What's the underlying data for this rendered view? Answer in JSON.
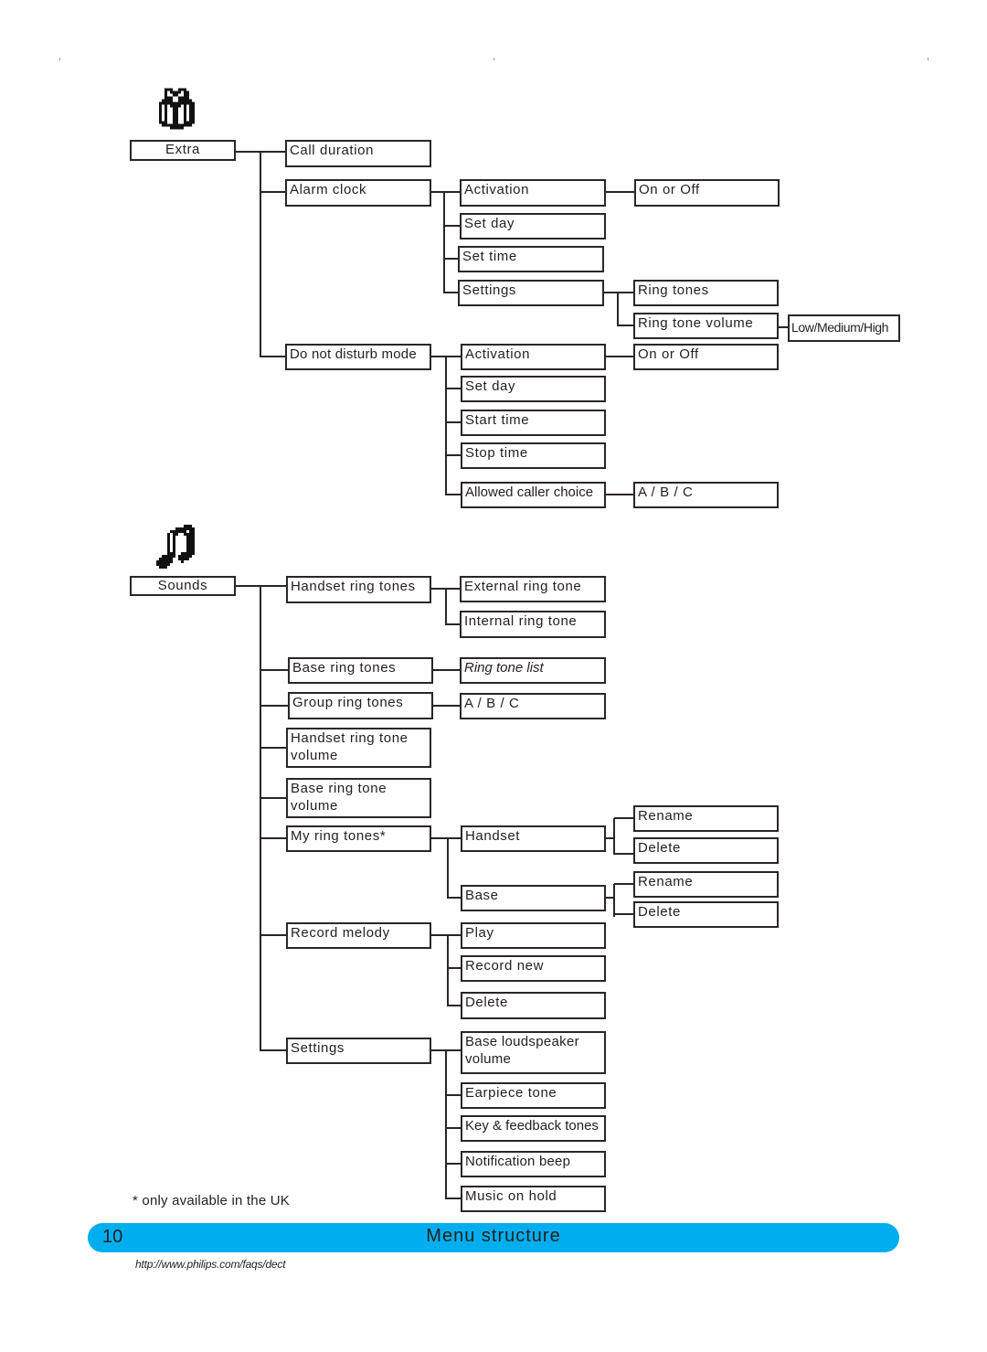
{
  "page": {
    "number": "10",
    "title": "Menu structure",
    "url": "http://www.philips.com/faqs/dect",
    "footnote": "* only available in the UK",
    "accent_color": "#00aeef"
  },
  "extra": {
    "icon": "gift-icon",
    "label": "Extra",
    "children": [
      {
        "label": "Call duration"
      },
      {
        "label": "Alarm clock",
        "children": [
          {
            "label": "Activation",
            "children": [
              {
                "label": "On or Off"
              }
            ]
          },
          {
            "label": "Set day"
          },
          {
            "label": "Set time"
          },
          {
            "label": "Settings",
            "children": [
              {
                "label": "Ring tones"
              },
              {
                "label": "Ring tone volume",
                "children": [
                  {
                    "label": "Low/Medium/High"
                  }
                ]
              }
            ]
          }
        ]
      },
      {
        "label": "Do not disturb mode",
        "children": [
          {
            "label": "Activation",
            "children": [
              {
                "label": "On or Off"
              }
            ]
          },
          {
            "label": "Set day"
          },
          {
            "label": "Start time"
          },
          {
            "label": "Stop time"
          },
          {
            "label": "Allowed caller choice",
            "children": [
              {
                "label": "A / B / C"
              }
            ]
          }
        ]
      }
    ]
  },
  "sounds": {
    "icon": "music-note-icon",
    "label": "Sounds",
    "children": [
      {
        "label": "Handset ring tones",
        "children": [
          {
            "label": "External ring tone"
          },
          {
            "label": "Internal ring tone"
          }
        ]
      },
      {
        "label": "Base ring tones",
        "children": [
          {
            "label": "Ring tone list"
          }
        ]
      },
      {
        "label": "Group ring tones",
        "children": [
          {
            "label": "A / B / C"
          }
        ]
      },
      {
        "label": "Handset ring tone volume"
      },
      {
        "label": "Base ring tone volume"
      },
      {
        "label": "My ring tones*",
        "children": [
          {
            "label": "Handset",
            "children": [
              {
                "label": "Rename"
              },
              {
                "label": "Delete"
              }
            ]
          },
          {
            "label": "Base",
            "children": [
              {
                "label": "Rename"
              },
              {
                "label": "Delete"
              }
            ]
          }
        ]
      },
      {
        "label": "Record melody",
        "children": [
          {
            "label": "Play"
          },
          {
            "label": "Record new"
          },
          {
            "label": "Delete"
          }
        ]
      },
      {
        "label": "Settings",
        "children": [
          {
            "label": "Base loudspeaker volume"
          },
          {
            "label": "Earpiece tone"
          },
          {
            "label": "Key & feedback tones"
          },
          {
            "label": "Notification beep"
          },
          {
            "label": "Music on hold"
          }
        ]
      }
    ]
  }
}
